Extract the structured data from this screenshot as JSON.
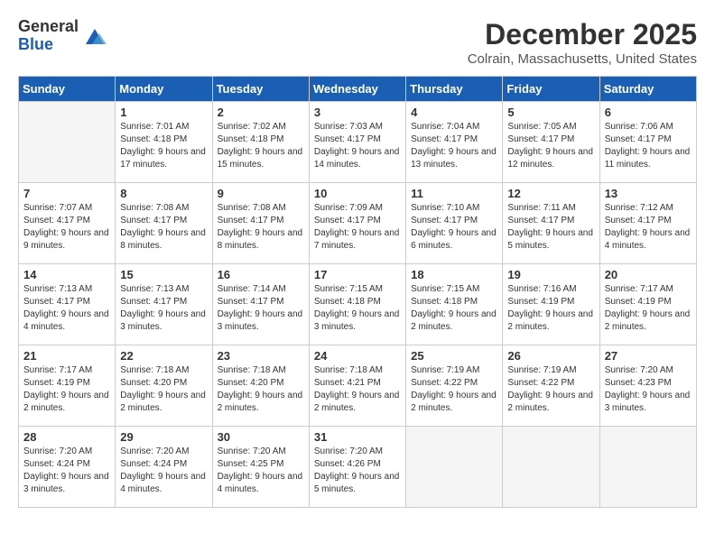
{
  "header": {
    "logo_general": "General",
    "logo_blue": "Blue",
    "month_title": "December 2025",
    "location": "Colrain, Massachusetts, United States"
  },
  "weekdays": [
    "Sunday",
    "Monday",
    "Tuesday",
    "Wednesday",
    "Thursday",
    "Friday",
    "Saturday"
  ],
  "weeks": [
    [
      {
        "day": "",
        "empty": true
      },
      {
        "day": "1",
        "sunrise": "Sunrise: 7:01 AM",
        "sunset": "Sunset: 4:18 PM",
        "daylight": "Daylight: 9 hours and 17 minutes."
      },
      {
        "day": "2",
        "sunrise": "Sunrise: 7:02 AM",
        "sunset": "Sunset: 4:18 PM",
        "daylight": "Daylight: 9 hours and 15 minutes."
      },
      {
        "day": "3",
        "sunrise": "Sunrise: 7:03 AM",
        "sunset": "Sunset: 4:17 PM",
        "daylight": "Daylight: 9 hours and 14 minutes."
      },
      {
        "day": "4",
        "sunrise": "Sunrise: 7:04 AM",
        "sunset": "Sunset: 4:17 PM",
        "daylight": "Daylight: 9 hours and 13 minutes."
      },
      {
        "day": "5",
        "sunrise": "Sunrise: 7:05 AM",
        "sunset": "Sunset: 4:17 PM",
        "daylight": "Daylight: 9 hours and 12 minutes."
      },
      {
        "day": "6",
        "sunrise": "Sunrise: 7:06 AM",
        "sunset": "Sunset: 4:17 PM",
        "daylight": "Daylight: 9 hours and 11 minutes."
      }
    ],
    [
      {
        "day": "7",
        "sunrise": "Sunrise: 7:07 AM",
        "sunset": "Sunset: 4:17 PM",
        "daylight": "Daylight: 9 hours and 9 minutes."
      },
      {
        "day": "8",
        "sunrise": "Sunrise: 7:08 AM",
        "sunset": "Sunset: 4:17 PM",
        "daylight": "Daylight: 9 hours and 8 minutes."
      },
      {
        "day": "9",
        "sunrise": "Sunrise: 7:08 AM",
        "sunset": "Sunset: 4:17 PM",
        "daylight": "Daylight: 9 hours and 8 minutes."
      },
      {
        "day": "10",
        "sunrise": "Sunrise: 7:09 AM",
        "sunset": "Sunset: 4:17 PM",
        "daylight": "Daylight: 9 hours and 7 minutes."
      },
      {
        "day": "11",
        "sunrise": "Sunrise: 7:10 AM",
        "sunset": "Sunset: 4:17 PM",
        "daylight": "Daylight: 9 hours and 6 minutes."
      },
      {
        "day": "12",
        "sunrise": "Sunrise: 7:11 AM",
        "sunset": "Sunset: 4:17 PM",
        "daylight": "Daylight: 9 hours and 5 minutes."
      },
      {
        "day": "13",
        "sunrise": "Sunrise: 7:12 AM",
        "sunset": "Sunset: 4:17 PM",
        "daylight": "Daylight: 9 hours and 4 minutes."
      }
    ],
    [
      {
        "day": "14",
        "sunrise": "Sunrise: 7:13 AM",
        "sunset": "Sunset: 4:17 PM",
        "daylight": "Daylight: 9 hours and 4 minutes."
      },
      {
        "day": "15",
        "sunrise": "Sunrise: 7:13 AM",
        "sunset": "Sunset: 4:17 PM",
        "daylight": "Daylight: 9 hours and 3 minutes."
      },
      {
        "day": "16",
        "sunrise": "Sunrise: 7:14 AM",
        "sunset": "Sunset: 4:17 PM",
        "daylight": "Daylight: 9 hours and 3 minutes."
      },
      {
        "day": "17",
        "sunrise": "Sunrise: 7:15 AM",
        "sunset": "Sunset: 4:18 PM",
        "daylight": "Daylight: 9 hours and 3 minutes."
      },
      {
        "day": "18",
        "sunrise": "Sunrise: 7:15 AM",
        "sunset": "Sunset: 4:18 PM",
        "daylight": "Daylight: 9 hours and 2 minutes."
      },
      {
        "day": "19",
        "sunrise": "Sunrise: 7:16 AM",
        "sunset": "Sunset: 4:19 PM",
        "daylight": "Daylight: 9 hours and 2 minutes."
      },
      {
        "day": "20",
        "sunrise": "Sunrise: 7:17 AM",
        "sunset": "Sunset: 4:19 PM",
        "daylight": "Daylight: 9 hours and 2 minutes."
      }
    ],
    [
      {
        "day": "21",
        "sunrise": "Sunrise: 7:17 AM",
        "sunset": "Sunset: 4:19 PM",
        "daylight": "Daylight: 9 hours and 2 minutes."
      },
      {
        "day": "22",
        "sunrise": "Sunrise: 7:18 AM",
        "sunset": "Sunset: 4:20 PM",
        "daylight": "Daylight: 9 hours and 2 minutes."
      },
      {
        "day": "23",
        "sunrise": "Sunrise: 7:18 AM",
        "sunset": "Sunset: 4:20 PM",
        "daylight": "Daylight: 9 hours and 2 minutes."
      },
      {
        "day": "24",
        "sunrise": "Sunrise: 7:18 AM",
        "sunset": "Sunset: 4:21 PM",
        "daylight": "Daylight: 9 hours and 2 minutes."
      },
      {
        "day": "25",
        "sunrise": "Sunrise: 7:19 AM",
        "sunset": "Sunset: 4:22 PM",
        "daylight": "Daylight: 9 hours and 2 minutes."
      },
      {
        "day": "26",
        "sunrise": "Sunrise: 7:19 AM",
        "sunset": "Sunset: 4:22 PM",
        "daylight": "Daylight: 9 hours and 2 minutes."
      },
      {
        "day": "27",
        "sunrise": "Sunrise: 7:20 AM",
        "sunset": "Sunset: 4:23 PM",
        "daylight": "Daylight: 9 hours and 3 minutes."
      }
    ],
    [
      {
        "day": "28",
        "sunrise": "Sunrise: 7:20 AM",
        "sunset": "Sunset: 4:24 PM",
        "daylight": "Daylight: 9 hours and 3 minutes."
      },
      {
        "day": "29",
        "sunrise": "Sunrise: 7:20 AM",
        "sunset": "Sunset: 4:24 PM",
        "daylight": "Daylight: 9 hours and 4 minutes."
      },
      {
        "day": "30",
        "sunrise": "Sunrise: 7:20 AM",
        "sunset": "Sunset: 4:25 PM",
        "daylight": "Daylight: 9 hours and 4 minutes."
      },
      {
        "day": "31",
        "sunrise": "Sunrise: 7:20 AM",
        "sunset": "Sunset: 4:26 PM",
        "daylight": "Daylight: 9 hours and 5 minutes."
      },
      {
        "day": "",
        "empty": true
      },
      {
        "day": "",
        "empty": true
      },
      {
        "day": "",
        "empty": true
      }
    ]
  ]
}
